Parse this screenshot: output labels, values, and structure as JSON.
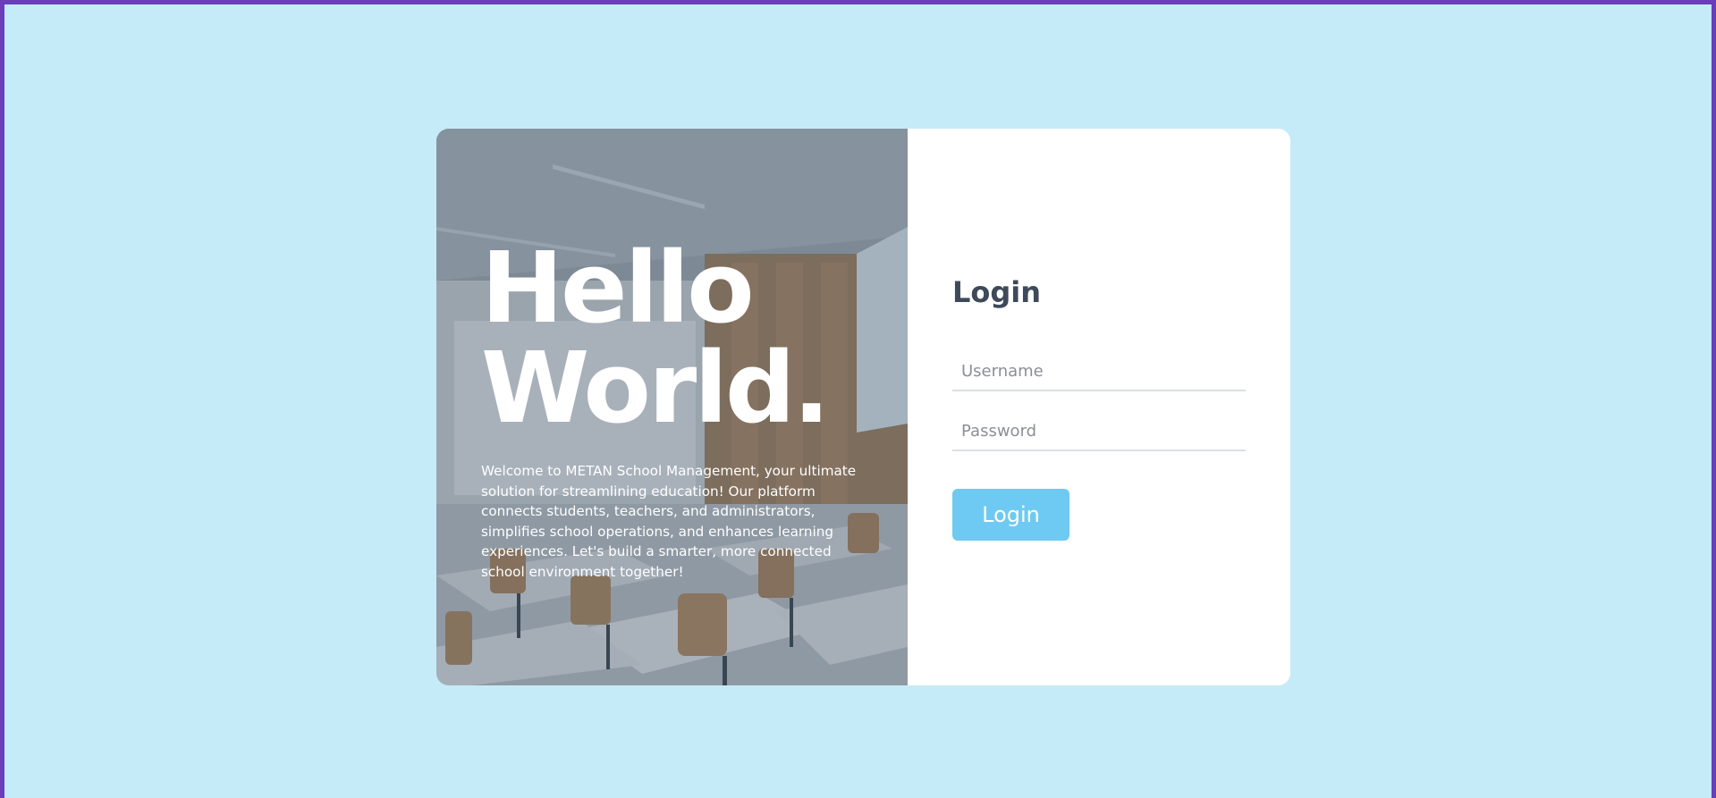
{
  "hero": {
    "title_line1": "Hello",
    "title_line2": "World.",
    "description": "Welcome to METAN School Management, your ultimate solution for streamlining education! Our platform connects students, teachers, and administrators, simplifies school operations, and enhances learning experiences. Let's build a smarter, more connected school environment together!",
    "image_icon": "classroom-photo"
  },
  "login": {
    "heading": "Login",
    "username_placeholder": "Username",
    "username_value": "",
    "password_placeholder": "Password",
    "password_value": "",
    "button_label": "Login"
  },
  "colors": {
    "page_background": "#c6ebf8",
    "frame_border": "#6a3dbb",
    "button": "#6ecaf2",
    "heading": "#3e4a5a",
    "card": "#ffffff"
  }
}
